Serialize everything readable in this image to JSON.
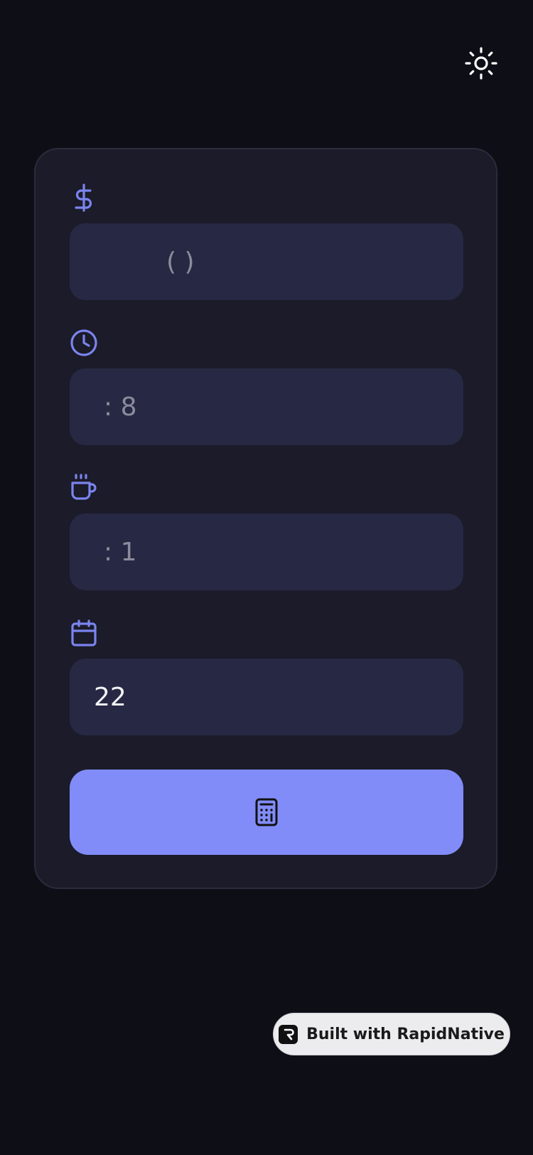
{
  "theme_toggle": {
    "icon": "sun-icon"
  },
  "form": {
    "fields": [
      {
        "icon": "dollar-icon",
        "value": "",
        "placeholder": "( )"
      },
      {
        "icon": "clock-icon",
        "value": "",
        "placeholder": ": 8"
      },
      {
        "icon": "coffee-icon",
        "value": "",
        "placeholder": ": 1"
      },
      {
        "icon": "calendar-icon",
        "value": "22",
        "placeholder": ""
      }
    ],
    "submit": {
      "icon": "calculator-icon"
    }
  },
  "badge": {
    "logo_icon": "rapidnative-logo-icon",
    "label": "Built with RapidNative"
  },
  "colors": {
    "background": "#0e0e16",
    "card": "#1b1b29",
    "input": "#272843",
    "accent": "#818cf8",
    "icon_accent": "#7b84ee"
  }
}
